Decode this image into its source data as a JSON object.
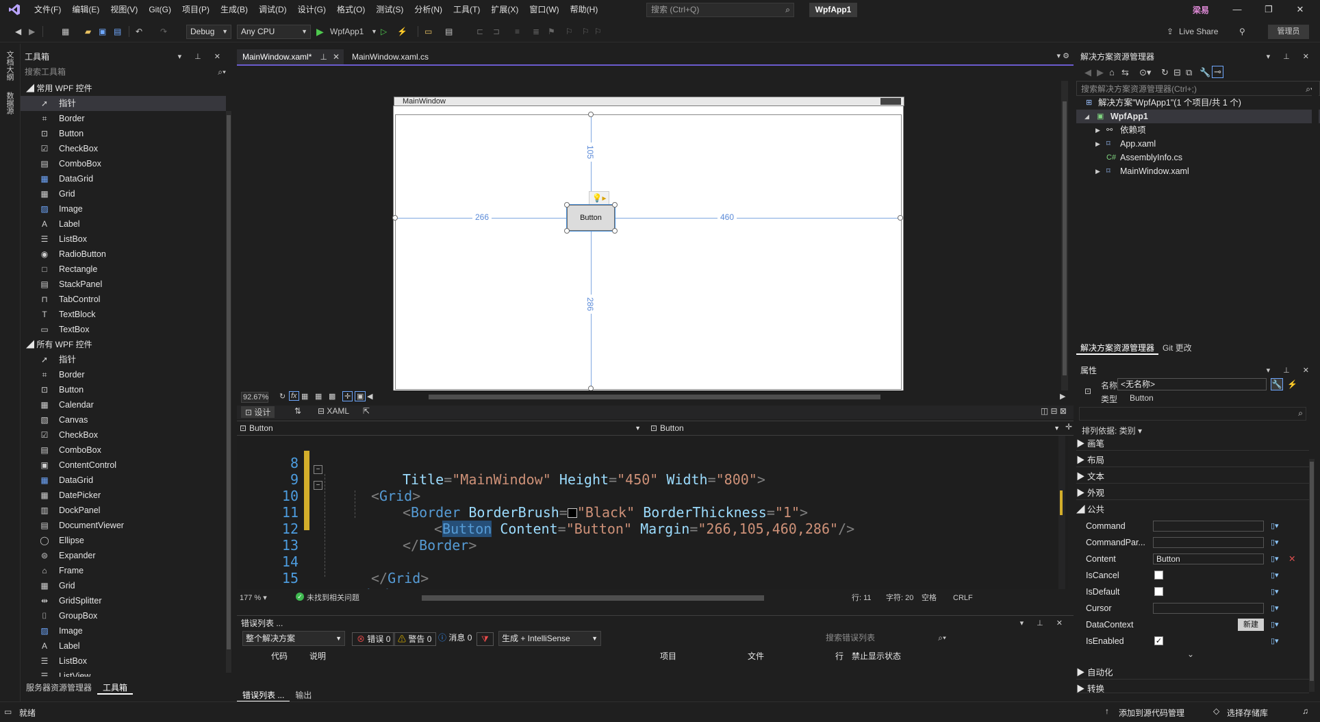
{
  "menubar": {
    "items": [
      "文件(F)",
      "编辑(E)",
      "视图(V)",
      "Git(G)",
      "项目(P)",
      "生成(B)",
      "调试(D)",
      "设计(G)",
      "格式(O)",
      "测试(S)",
      "分析(N)",
      "工具(T)",
      "扩展(X)",
      "窗口(W)",
      "帮助(H)"
    ],
    "search_placeholder": "搜索 (Ctrl+Q)",
    "app_name": "WpfApp1",
    "user_badge": "梁易"
  },
  "toolbar": {
    "config": "Debug",
    "platform": "Any CPU",
    "run_label": "WpfApp1",
    "live_share": "Live Share",
    "admin": "管理员"
  },
  "left_rail": {
    "tab1": "文档大纲",
    "tab2": "数据源"
  },
  "toolbox": {
    "title": "工具箱",
    "search_placeholder": "搜索工具箱",
    "group1": "常用 WPF 控件",
    "group1_items": [
      "指针",
      "Border",
      "Button",
      "CheckBox",
      "ComboBox",
      "DataGrid",
      "Grid",
      "Image",
      "Label",
      "ListBox",
      "RadioButton",
      "Rectangle",
      "StackPanel",
      "TabControl",
      "TextBlock",
      "TextBox"
    ],
    "group2": "所有 WPF 控件",
    "group2_items": [
      "指针",
      "Border",
      "Button",
      "Calendar",
      "Canvas",
      "CheckBox",
      "ComboBox",
      "ContentControl",
      "DataGrid",
      "DatePicker",
      "DockPanel",
      "DocumentViewer",
      "Ellipse",
      "Expander",
      "Frame",
      "Grid",
      "GridSplitter",
      "GroupBox",
      "Image",
      "Label",
      "ListBox",
      "ListView"
    ],
    "bottom_tabs": [
      "服务器资源管理器",
      "工具箱"
    ]
  },
  "editor": {
    "tabs": [
      "MainWindow.xaml*",
      "MainWindow.xaml.cs"
    ],
    "designer": {
      "window_title": "MainWindow",
      "button_text": "Button",
      "margin_left": "266",
      "margin_top": "105",
      "margin_right": "460",
      "margin_bottom": "286"
    },
    "zoom": "92.67%",
    "view_design": "设计",
    "view_xaml": "XAML",
    "nav_left": "Button",
    "nav_right": "Button",
    "code_lines": [
      {
        "num": "8"
      },
      {
        "num": "9"
      },
      {
        "num": "10"
      },
      {
        "num": "11"
      },
      {
        "num": "12"
      },
      {
        "num": "13"
      },
      {
        "num": "14"
      },
      {
        "num": "15"
      }
    ],
    "code_zoom": "177 %",
    "no_issues": "未找到相关问题",
    "position": "行: 11",
    "column": "字符: 20",
    "space": "空格",
    "eol": "CRLF"
  },
  "solution": {
    "title": "解决方案资源管理器",
    "search_placeholder": "搜索解决方案资源管理器(Ctrl+;)",
    "root": "解决方案\"WpfApp1\"(1 个项目/共 1 个)",
    "project": "WpfApp1",
    "children": [
      "依赖项",
      "App.xaml",
      "AssemblyInfo.cs",
      "MainWindow.xaml"
    ],
    "tabs": [
      "解决方案资源管理器",
      "Git 更改"
    ]
  },
  "properties": {
    "title": "属性",
    "name_label": "名称",
    "name_value": "<无名称>",
    "type_label": "类型",
    "type_value": "Button",
    "sort_label": "排列依据: 类别",
    "categories": [
      "画笔",
      "布局",
      "文本",
      "外观",
      "公共",
      "自动化",
      "转换"
    ],
    "rows": [
      {
        "name": "Command",
        "value": ""
      },
      {
        "name": "CommandPar...",
        "value": ""
      },
      {
        "name": "Content",
        "value": "Button"
      },
      {
        "name": "IsCancel",
        "value": ""
      },
      {
        "name": "IsDefault",
        "value": ""
      },
      {
        "name": "Cursor",
        "value": ""
      },
      {
        "name": "DataContext",
        "value": "新建"
      },
      {
        "name": "IsEnabled",
        "value": "✓"
      }
    ]
  },
  "errors": {
    "title": "错误列表 ...",
    "scope": "整个解决方案",
    "errors": "错误 0",
    "warnings": "警告 0",
    "messages": "消息 0",
    "build_filter": "生成 + IntelliSense",
    "search": "搜索错误列表",
    "columns": [
      "代码",
      "说明",
      "项目",
      "文件",
      "行",
      "禁止显示状态"
    ],
    "bottom_tabs": [
      "错误列表 ...",
      "输出"
    ]
  },
  "statusbar": {
    "ready": "就绪",
    "source_control": "添加到源代码管理",
    "repo": "选择存储库"
  }
}
